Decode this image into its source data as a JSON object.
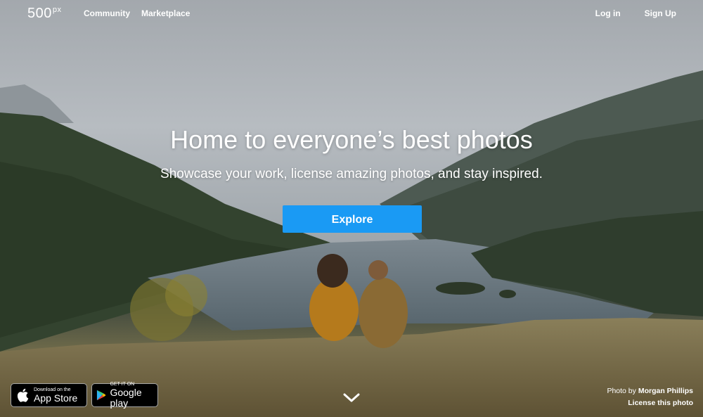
{
  "nav": {
    "logo_main": "500",
    "logo_sup": "px",
    "community": "Community",
    "marketplace": "Marketplace",
    "login": "Log in",
    "signup": "Sign Up"
  },
  "hero": {
    "headline": "Home to everyone’s best photos",
    "subheadline": "Showcase your work, license amazing photos, and stay inspired.",
    "cta_label": "Explore",
    "cta_color": "#1a9af4"
  },
  "badges": {
    "appstore_small": "Download on the",
    "appstore_big": "App Store",
    "gplay_small": "GET IT ON",
    "gplay_big": "Google play"
  },
  "credit": {
    "prefix": "Photo by",
    "photographer": "Morgan Phillips",
    "license": "License this photo"
  },
  "icons": {
    "apple": "apple-icon",
    "google_play": "google-play-icon",
    "scroll": "chevron-down-icon"
  }
}
